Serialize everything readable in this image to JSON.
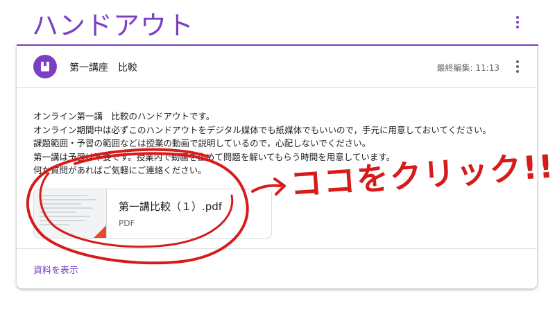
{
  "page": {
    "title": "ハンドアウト"
  },
  "card": {
    "header_title": "第一講座　比較",
    "header_time": "最終編集: 11:13",
    "body_lines": [
      "オンライン第一講　比較のハンドアウトです。",
      "オンライン期間中は必ずこのハンドアウトをデジタル媒体でも紙媒体でもいいので，手元に用意しておいてください。",
      "課題範囲・予習の範囲などは授業の動画で説明しているので，心配しないでください。",
      "第一講は予習は不要です。授業内で動画を止めて問題を解いてもらう時間を用意しています。",
      "何か質問があればご気軽にご連絡ください。"
    ],
    "attachment": {
      "title": "第一講比較（１）.pdf",
      "type": "PDF"
    },
    "view_link": "資料を表示"
  },
  "annotation": {
    "text": "ココをクリック!!",
    "color": "#d61b1b"
  },
  "colors": {
    "accent": "#7b3fc4",
    "pdf": "#e8492f"
  },
  "icons": {
    "avatar": "book-icon",
    "more": "more-vert-icon"
  }
}
